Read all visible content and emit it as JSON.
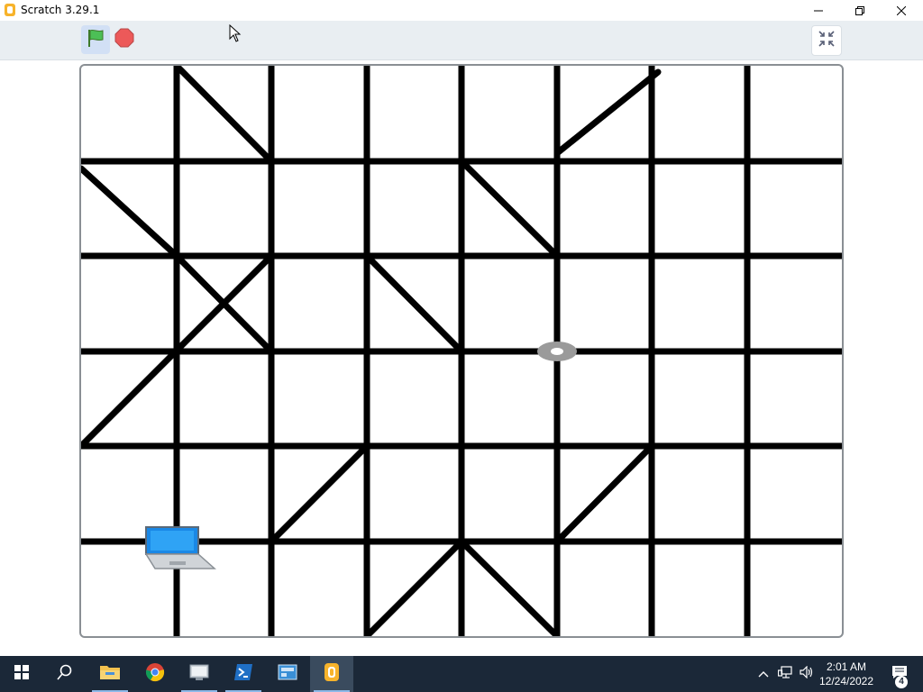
{
  "window": {
    "title": "Scratch 3.29.1",
    "buttons": [
      "minimize",
      "restore",
      "close"
    ]
  },
  "toolbar": {
    "green_flag_icon": "green-flag-icon",
    "stop_icon": "stop-icon",
    "unfullscreen_icon": "exit-fullscreen-icon"
  },
  "stage": {
    "sprites": [
      {
        "name": "laptop",
        "icon": "laptop-icon"
      },
      {
        "name": "ball",
        "icon": "ball-icon"
      }
    ]
  },
  "taskbar": {
    "items": [
      {
        "name": "start",
        "icon": "windows-start-icon"
      },
      {
        "name": "search",
        "icon": "search-icon"
      },
      {
        "name": "file-explorer",
        "icon": "folder-icon"
      },
      {
        "name": "chrome",
        "icon": "chrome-icon"
      },
      {
        "name": "app-4",
        "icon": "app-icon"
      },
      {
        "name": "powershell",
        "icon": "powershell-icon"
      },
      {
        "name": "app-6",
        "icon": "app-icon"
      },
      {
        "name": "scratch",
        "icon": "scratch-icon"
      }
    ],
    "time": "2:01 AM",
    "date": "12/24/2022",
    "notification_count": "4"
  }
}
